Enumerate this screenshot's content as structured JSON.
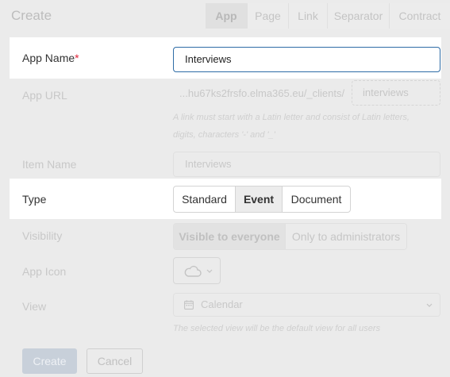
{
  "header": {
    "title": "Create",
    "tabs": [
      {
        "label": "App",
        "active": true
      },
      {
        "label": "Page"
      },
      {
        "label": "Link"
      },
      {
        "label": "Separator"
      },
      {
        "label": "Contract"
      }
    ]
  },
  "form": {
    "app_name": {
      "label": "App Name",
      "required_mark": "*",
      "value": "Interviews"
    },
    "app_url": {
      "label": "App URL",
      "prefix": "...hu67ks2frsfo.elma365.eu/_clients/",
      "value": "interviews",
      "hint": "A link must start with a Latin letter and consist of Latin letters, digits, characters '-' and '_'"
    },
    "item_name": {
      "label": "Item Name",
      "value": "Interviews"
    },
    "type": {
      "label": "Type",
      "options": [
        "Standard",
        "Event",
        "Document"
      ],
      "selected": "Event"
    },
    "visibility": {
      "label": "Visibility",
      "options": [
        "Visible to everyone",
        "Only to administrators"
      ],
      "selected": "Visible to everyone"
    },
    "app_icon": {
      "label": "App Icon",
      "icon": "cloud-icon"
    },
    "view": {
      "label": "View",
      "value": "Calendar",
      "icon": "calendar-icon",
      "hint": "The selected view will be the default view for all users"
    }
  },
  "actions": {
    "create": "Create",
    "cancel": "Cancel"
  },
  "colors": {
    "accent": "#2e6ca6",
    "required": "#e0263a",
    "background": "#ebebeb"
  }
}
